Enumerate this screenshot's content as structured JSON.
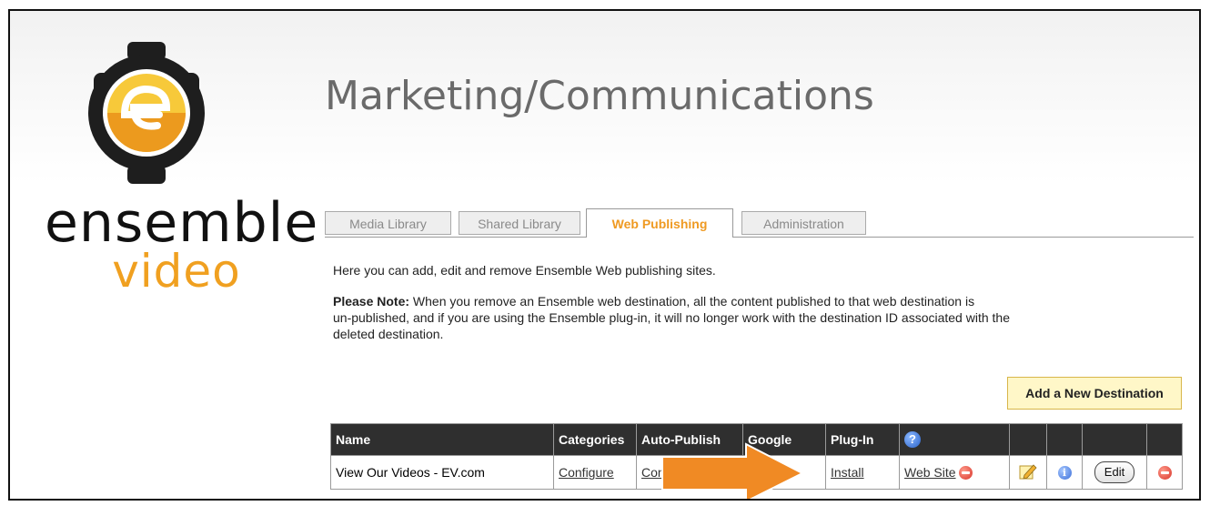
{
  "brand": {
    "word1": "ensemble",
    "word2": "video",
    "primary_color": "#f0a020",
    "dark_color": "#1e1e1e"
  },
  "page": {
    "title": "Marketing/Communications"
  },
  "tabs": [
    {
      "label": "Media Library",
      "active": false
    },
    {
      "label": "Shared Library",
      "active": false
    },
    {
      "label": "Web Publishing",
      "active": true
    },
    {
      "label": "Administration",
      "active": false
    }
  ],
  "intro": "Here you can add, edit and remove Ensemble Web publishing sites.",
  "note": {
    "label": "Please Note:",
    "line1": " When you remove an Ensemble web destination, all the content published to that web destination is",
    "line2": "un-published, and if you are using the Ensemble plug-in, it will no longer work with the destination ID associated with the",
    "line3": "deleted destination."
  },
  "add_button": "Add a New Destination",
  "table": {
    "headers": {
      "name": "Name",
      "categories": "Categories",
      "autopublish": "Auto-Publish",
      "google": "Google",
      "plugin": "Plug-In"
    },
    "rows": [
      {
        "name": "View Our Videos - EV.com",
        "categories": "Configure",
        "autopublish": "Configure",
        "plugin": "Install",
        "website": "Web Site",
        "edit": "Edit"
      }
    ]
  },
  "annotation": {
    "type": "arrow",
    "color": "#f08a24",
    "points_to": "Install"
  }
}
